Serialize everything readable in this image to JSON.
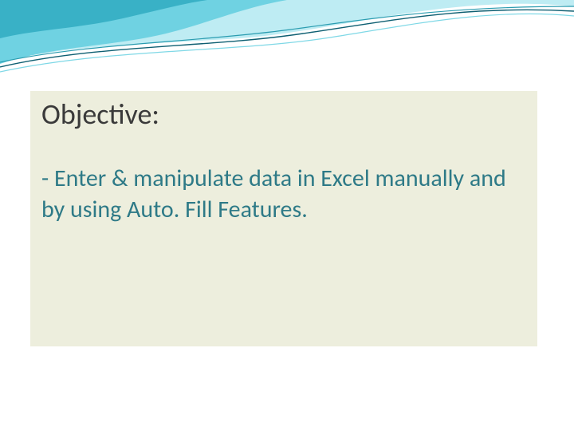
{
  "slide": {
    "title": "Objective:",
    "body": "- Enter & manipulate data in Excel manually and by using Auto. Fill Features."
  },
  "theme": {
    "accent": "#2e7a87",
    "card_bg": "#edeedd",
    "wave_dark": "#0e5f72",
    "wave_mid": "#49b5c8",
    "wave_light": "#a6e4ee"
  }
}
